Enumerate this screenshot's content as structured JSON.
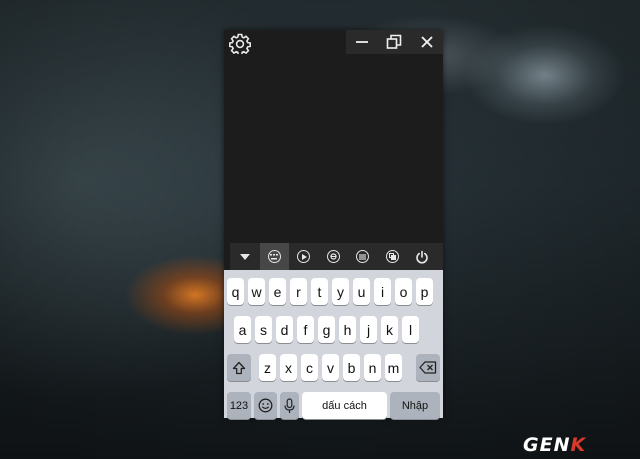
{
  "window": {
    "icons": {
      "settings": "gear-icon",
      "minimize": "minimize-icon",
      "restore": "restore-icon",
      "close": "close-icon"
    }
  },
  "toolbar": {
    "items": [
      "collapse-icon",
      "keyboard-icon",
      "play-icon",
      "browser-icon",
      "menu-icon",
      "copy-screen-icon",
      "power-icon"
    ],
    "active": "keyboard-icon"
  },
  "keyboard": {
    "row1": [
      "q",
      "w",
      "e",
      "r",
      "t",
      "y",
      "u",
      "i",
      "o",
      "p"
    ],
    "row2": [
      "a",
      "s",
      "d",
      "f",
      "g",
      "h",
      "j",
      "k",
      "l"
    ],
    "row3": [
      "z",
      "x",
      "c",
      "v",
      "b",
      "n",
      "m"
    ],
    "numbers_label": "123",
    "space_label": "dấu cách",
    "return_label": "Nhập"
  },
  "watermark": {
    "brand_main": "GEN",
    "brand_accent": "K"
  },
  "colors": {
    "window_bg": "#1c1c1c",
    "keyboard_bg": "#d2d5db",
    "key_bg": "#ffffff",
    "function_key_bg": "#adb3bc",
    "brand_accent": "#d83a2a"
  }
}
